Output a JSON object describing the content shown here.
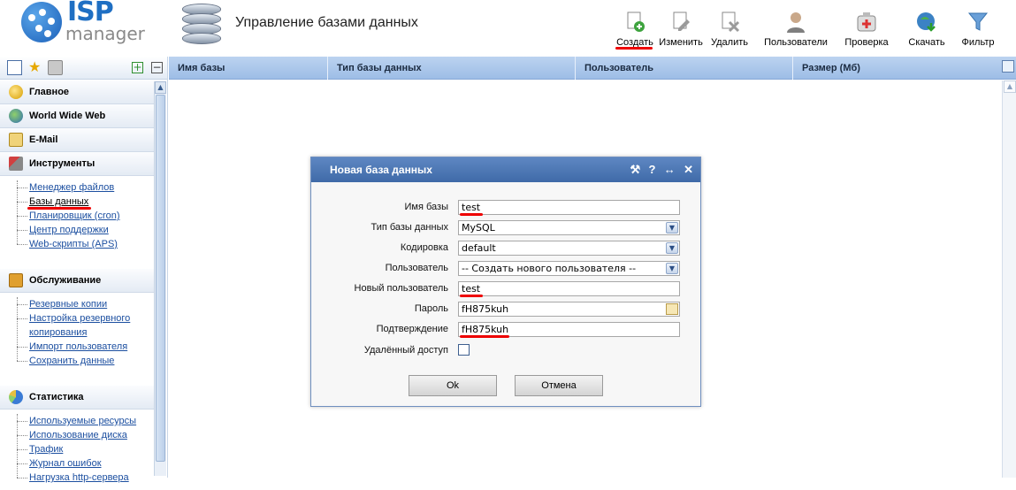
{
  "logo": {
    "brand": "ISP",
    "product": "manager"
  },
  "header": {
    "title": "Управление базами данных"
  },
  "toolbar": {
    "buttons": [
      {
        "label": "Создать",
        "icon": "create-icon"
      },
      {
        "label": "Изменить",
        "icon": "edit-icon"
      },
      {
        "label": "Удалить",
        "icon": "delete-icon"
      },
      {
        "label": "Пользователи",
        "icon": "users-icon"
      },
      {
        "label": "Проверка",
        "icon": "check-icon"
      },
      {
        "label": "Скачать",
        "icon": "download-icon"
      },
      {
        "label": "Фильтр",
        "icon": "filter-icon"
      }
    ]
  },
  "sidebar": {
    "sections": [
      {
        "label": "Главное",
        "icon": "home-icon",
        "items": []
      },
      {
        "label": "World Wide Web",
        "icon": "globe-icon",
        "items": []
      },
      {
        "label": "E-Mail",
        "icon": "mail-icon",
        "items": []
      },
      {
        "label": "Инструменты",
        "icon": "tools-icon",
        "items": [
          "Менеджер файлов",
          "Базы данных",
          "Планировщик (cron)",
          "Центр поддержки",
          "Web-скрипты (APS)"
        ]
      },
      {
        "label": "Обслуживание",
        "icon": "maintenance-icon",
        "items": [
          "Резервные копии",
          "Настройка резервного копирования",
          "Импорт пользователя",
          "Сохранить данные"
        ]
      },
      {
        "label": "Статистика",
        "icon": "stats-icon",
        "items": [
          "Используемые ресурсы",
          "Использование диска",
          "Трафик",
          "Журнал ошибок",
          "Нагрузка http-сервера"
        ]
      }
    ]
  },
  "table": {
    "columns": [
      "Имя базы",
      "Тип базы данных",
      "Пользователь",
      "Размер (Мб)"
    ]
  },
  "dialog": {
    "title": "Новая база данных",
    "tools": [
      "⚒",
      "?",
      "↔",
      "✕"
    ],
    "fields": {
      "db_name": {
        "label": "Имя базы",
        "value": "test"
      },
      "db_type": {
        "label": "Тип базы данных",
        "value": "MySQL"
      },
      "encoding": {
        "label": "Кодировка",
        "value": "default"
      },
      "user": {
        "label": "Пользователь",
        "value": "-- Создать нового пользователя --"
      },
      "new_user": {
        "label": "Новый пользователь",
        "value": "test"
      },
      "password": {
        "label": "Пароль",
        "value": "fH875kuh"
      },
      "confirm": {
        "label": "Подтверждение",
        "value": "fH875kuh"
      },
      "remote": {
        "label": "Удалённый доступ",
        "checked": false
      }
    },
    "ok_label": "Ok",
    "cancel_label": "Отмена"
  },
  "colors": {
    "accent": "#3f6aa8",
    "header_blue": "#9dbde6",
    "link": "#1c4fa0",
    "highlight_underline": "#e00000"
  }
}
